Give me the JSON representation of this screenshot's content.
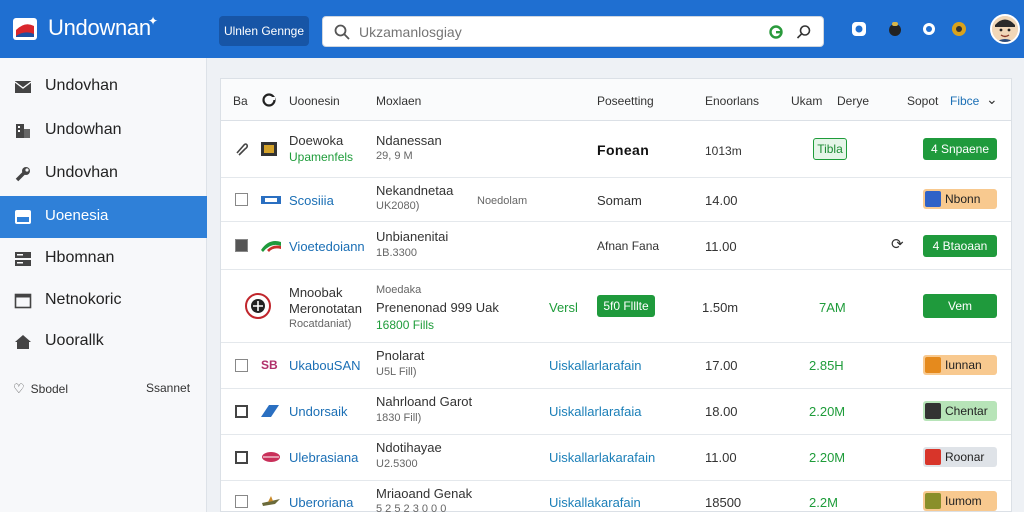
{
  "app": {
    "title": "Undownan",
    "top_button": "Ulnlen Gennge"
  },
  "search": {
    "placeholder": "Ukzamanlosgiay"
  },
  "sidebar": {
    "items": [
      {
        "label": "Undovhan",
        "icon": "mail-icon"
      },
      {
        "label": "Undowhan",
        "icon": "building-icon"
      },
      {
        "label": "Undovhan",
        "icon": "wrench-icon"
      },
      {
        "label": "Uoenesia",
        "icon": "inbox-icon",
        "active": true
      },
      {
        "label": "Hbomnan",
        "icon": "server-icon"
      },
      {
        "label": "Netnokoric",
        "icon": "window-icon"
      },
      {
        "label": "Uoorallk",
        "icon": "home-icon"
      }
    ],
    "footer_left": "Sbodel",
    "footer_right": "Ssannet"
  },
  "table": {
    "headers": {
      "c0": "Ba",
      "c1": "Uoonesin",
      "c2": "Moxlaen",
      "c3": "Poseetting",
      "c4": "Enoorlans",
      "c5": "Ukam",
      "c6": "Derye",
      "c7": "Sopot",
      "c8": "Fibce"
    },
    "rows": [
      {
        "name": "Doewoka",
        "name_sub": "Upamenfels",
        "detail": "Ndanessan",
        "detail_sub": "29, 9 M",
        "extra": "Fonean",
        "size": "1013m",
        "status": "Tibla",
        "action": "4 Snpaene"
      },
      {
        "name": "Scosiiia",
        "detail": "Nekandnetaa",
        "detail_sub": "UK2080)",
        "extra_mid": "Noedolam",
        "extra": "Somam",
        "size": "14.00",
        "action": "Nbonn"
      },
      {
        "name": "Vioetedoiann",
        "detail": "Unbianenitai",
        "detail_sub": "1B.3300",
        "extra": "Afnan Fana",
        "size": "11.00",
        "action": "4 Btaoaan"
      },
      {
        "name": "Mnoobak",
        "name_line2": "Meronotatan",
        "name_sub": "Rocatdaniat)",
        "detail": "Moedaka",
        "detail_line2": "Prenenonad 999 Uak",
        "detail_sub": "16800 Fills",
        "vers": "Versl",
        "status": "5f0 Flllte",
        "size": "1.50m",
        "size2": "7AM",
        "action": "Vem"
      },
      {
        "name": "UkabouSAN",
        "detail": "Pnolarat",
        "detail_sub": "U5L Fill)",
        "extra": "Uiskallarlarafain",
        "size": "17.00",
        "size2": "2.85H",
        "action": "Iunnan"
      },
      {
        "name": "Undorsaik",
        "detail": "Nahrloand Garot",
        "detail_sub": "1830 Fill)",
        "extra": "Uiskallarlarafaia",
        "size": "18.00",
        "size2": "2.20M",
        "action": "Chentar"
      },
      {
        "name": "Ulebrasiana",
        "detail": "Ndotihayae",
        "detail_sub": "U2.5300",
        "extra": "Uiskallarlakarafain",
        "size": "11.00",
        "size2": "2.20M",
        "action": "Roonar"
      },
      {
        "name": "Uberoriana",
        "detail": "Mriaoand Genak",
        "detail_sub": "5 2 5 2 3 0 0 0",
        "extra": "Uiskallakarafain",
        "size": "18500",
        "size2": "2.2M",
        "action": "Iumom"
      }
    ]
  },
  "colors": {
    "topbar": "#1f6fd1",
    "active_nav": "#2f80d8",
    "green": "#1f9a3c",
    "link_blue": "#1b6fb5"
  }
}
